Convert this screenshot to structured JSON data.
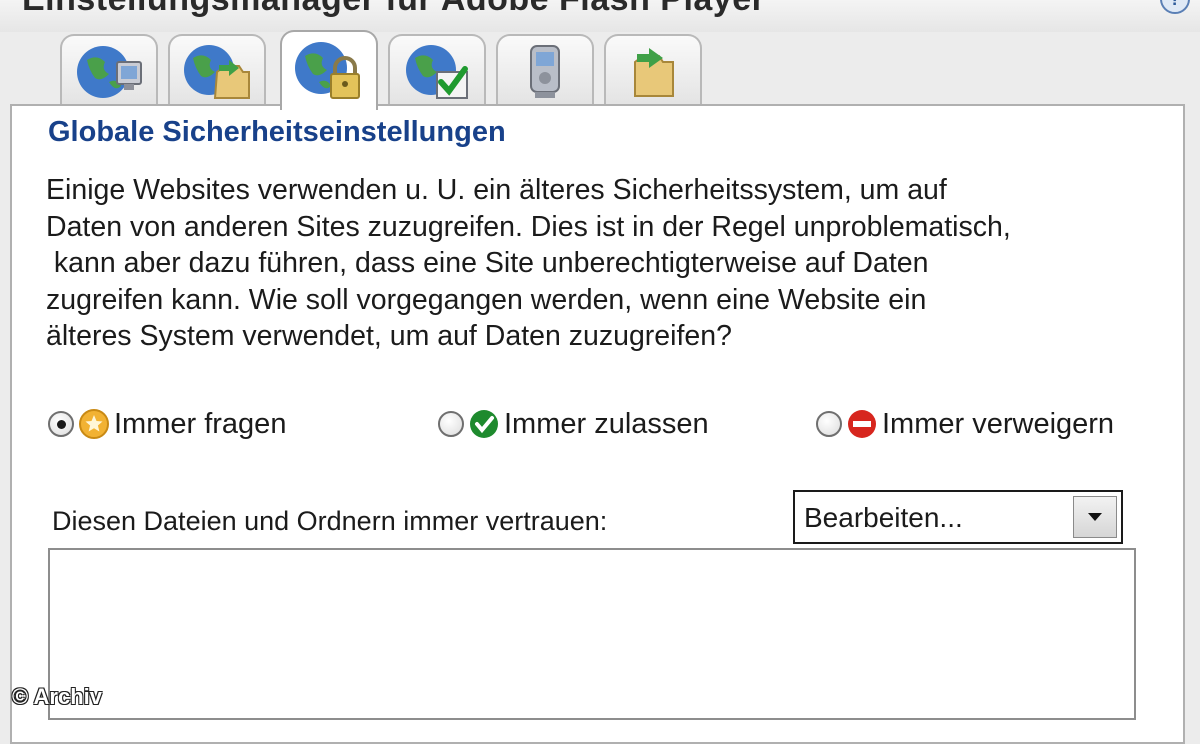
{
  "window": {
    "title": "Einstellungsmanager für Adobe Flash Player"
  },
  "tabs": [
    {
      "icon": "globe-monitor-icon"
    },
    {
      "icon": "globe-folder-icon"
    },
    {
      "icon": "globe-lock-icon",
      "active": true
    },
    {
      "icon": "globe-checkmark-icon"
    },
    {
      "icon": "device-icon"
    },
    {
      "icon": "folder-arrow-icon"
    }
  ],
  "section": {
    "title": "Globale Sicherheitseinstellungen",
    "description_lines": [
      "Einige Websites verwenden u. U. ein älteres Sicherheitssystem, um auf",
      "Daten von anderen Sites zuzugreifen. Dies ist in der Regel unproblematisch,",
      " kann aber dazu führen, dass eine Site unberechtigterweise auf Daten",
      "zugreifen kann. Wie soll vorgegangen werden, wenn eine Website ein",
      "älteres System verwendet, um auf Daten zuzugreifen?"
    ]
  },
  "options": [
    {
      "label": "Immer fragen",
      "selected": true,
      "icon": "ask-icon",
      "color": "#f2b233"
    },
    {
      "label": "Immer zulassen",
      "selected": false,
      "icon": "allow-check-icon",
      "color": "#1e8a2e"
    },
    {
      "label": "Immer verweigern",
      "selected": false,
      "icon": "deny-icon",
      "color": "#d7261e"
    }
  ],
  "trust": {
    "label": "Diesen Dateien und Ordnern immer vertrauen:",
    "dropdown_value": "Bearbeiten..."
  },
  "watermark": "© Archiv",
  "colors": {
    "section_title": "#18418a",
    "panel_border": "#b0b0b0"
  }
}
